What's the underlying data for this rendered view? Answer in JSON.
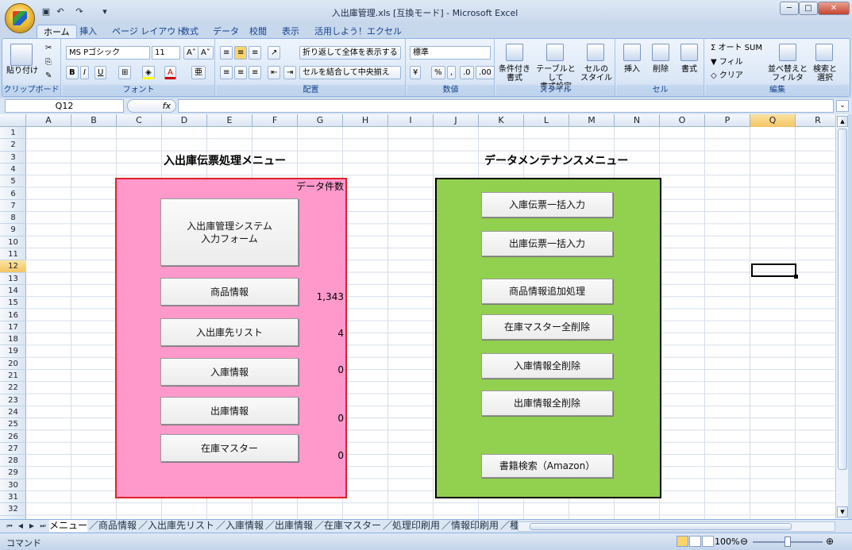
{
  "window": {
    "title": "入出庫管理.xls [互換モード] - Microsoft Excel"
  },
  "tabs": [
    "ホーム",
    "挿入",
    "ページ レイアウト",
    "数式",
    "データ",
    "校閲",
    "表示",
    "活用しよう！エクセル"
  ],
  "ribbon": {
    "clipboard": {
      "label": "クリップボード",
      "paste": "貼り付け"
    },
    "font": {
      "label": "フォント",
      "name": "MS Pゴシック",
      "size": "11"
    },
    "alignment": {
      "label": "配置",
      "wrap": "折り返して全体を表示する",
      "merge": "セルを結合して中央揃え"
    },
    "number": {
      "label": "数値",
      "format": "標準"
    },
    "styles": {
      "label": "スタイル",
      "conditional": "条件付き\n書式",
      "table": "テーブルとして\n書式設定",
      "cell": "セルの\nスタイル"
    },
    "cells": {
      "label": "セル",
      "insert": "挿入",
      "delete": "削除",
      "format": "書式"
    },
    "editing": {
      "label": "編集",
      "autosum": "オート SUM",
      "fill": "フィル",
      "clear": "クリア",
      "sort": "並べ替えと\nフィルタ",
      "find": "検索と\n選択"
    }
  },
  "formula_bar": {
    "name_box": "Q12",
    "fx": "fx",
    "value": ""
  },
  "columns": [
    "A",
    "B",
    "C",
    "D",
    "E",
    "F",
    "G",
    "H",
    "I",
    "J",
    "K",
    "L",
    "M",
    "N",
    "O",
    "P",
    "Q",
    "R"
  ],
  "selected_column": "Q",
  "rows": [
    "1",
    "2",
    "3",
    "4",
    "5",
    "6",
    "7",
    "8",
    "9",
    "10",
    "11",
    "12",
    "13",
    "14",
    "15",
    "16",
    "17",
    "18",
    "19",
    "20",
    "21",
    "22",
    "23",
    "24",
    "25",
    "26",
    "27",
    "28",
    "29",
    "30",
    "31",
    "32"
  ],
  "selected_row": "12",
  "left_menu": {
    "title": "入出庫伝票処理メニュー",
    "count_header": "データ件数",
    "color": "#ff99cc",
    "border": "#e0202a",
    "buttons": [
      "入出庫管理システム\n入力フォーム",
      "商品情報",
      "入出庫先リスト",
      "入庫情報",
      "出庫情報",
      "在庫マスター"
    ],
    "counts": [
      "1,343",
      "4",
      "0",
      "0",
      "0"
    ]
  },
  "right_menu": {
    "title": "データメンテナンスメニュー",
    "color": "#92d050",
    "border": "#000000",
    "buttons": [
      "入庫伝票一括入力",
      "出庫伝票一括入力",
      "商品情報追加処理",
      "在庫マスター全削除",
      "入庫情報全削除",
      "出庫情報全削除",
      "書籍検索（Amazon）"
    ]
  },
  "sheet_tabs": [
    "メニュー",
    "商品情報",
    "入出庫先リスト",
    "入庫情報",
    "出庫情報",
    "在庫マスター",
    "処理印刷用",
    "情報印刷用",
    "種別"
  ],
  "status": {
    "mode": "コマンド",
    "zoom": "100%"
  }
}
